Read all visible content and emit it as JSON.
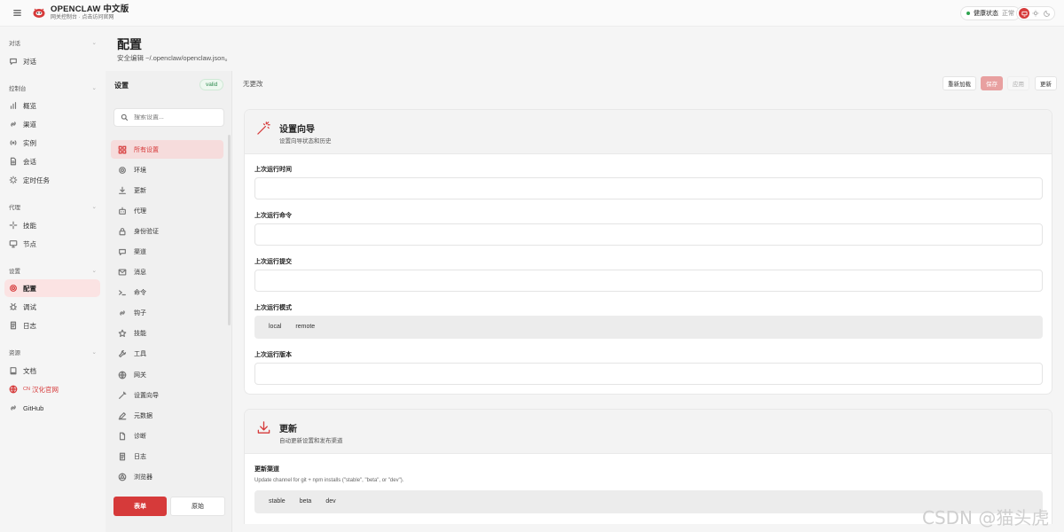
{
  "app": {
    "title": "OPENCLAW 中文版",
    "subtitle": "网关控制台 · 点击访问官网"
  },
  "health": {
    "label": "健康状态",
    "value": "正常"
  },
  "nav": {
    "sections": [
      {
        "label": "对话",
        "items": [
          {
            "label": "对话",
            "icon": "chat-bubble-icon"
          }
        ]
      },
      {
        "label": "控制台",
        "items": [
          {
            "label": "概览",
            "icon": "bar-chart-icon"
          },
          {
            "label": "渠道",
            "icon": "link-icon"
          },
          {
            "label": "实例",
            "icon": "radio-icon"
          },
          {
            "label": "会话",
            "icon": "document-icon"
          },
          {
            "label": "定时任务",
            "icon": "loader-icon"
          }
        ]
      },
      {
        "label": "代理",
        "items": [
          {
            "label": "技能",
            "icon": "sparkle-icon"
          },
          {
            "label": "节点",
            "icon": "monitor-icon"
          }
        ]
      },
      {
        "label": "设置",
        "items": [
          {
            "label": "配置",
            "icon": "gear-icon",
            "active": true
          },
          {
            "label": "调试",
            "icon": "bug-icon"
          },
          {
            "label": "日志",
            "icon": "file-text-icon"
          }
        ]
      },
      {
        "label": "资源",
        "items": [
          {
            "label": "文档",
            "icon": "book-icon"
          },
          {
            "label": "汉化官网",
            "icon": "globe-icon",
            "badge": "CN"
          },
          {
            "label": "GitHub",
            "icon": "link-icon"
          }
        ]
      }
    ]
  },
  "page": {
    "title": "配置",
    "subtitle": "安全编辑 ~/.openclaw/openclaw.json。"
  },
  "settings_panel": {
    "title": "设置",
    "status": "valid",
    "search_placeholder": "搜索设置...",
    "items": [
      {
        "label": "所有设置",
        "icon": "grid-icon",
        "active": true
      },
      {
        "label": "环境",
        "icon": "gear-icon"
      },
      {
        "label": "更新",
        "icon": "download-icon"
      },
      {
        "label": "代理",
        "icon": "robot-icon"
      },
      {
        "label": "身份验证",
        "icon": "lock-icon"
      },
      {
        "label": "渠道",
        "icon": "chat-bubble-icon"
      },
      {
        "label": "消息",
        "icon": "mail-icon"
      },
      {
        "label": "命令",
        "icon": "terminal-icon"
      },
      {
        "label": "钩子",
        "icon": "link-icon"
      },
      {
        "label": "技能",
        "icon": "star-icon"
      },
      {
        "label": "工具",
        "icon": "wrench-icon"
      },
      {
        "label": "网关",
        "icon": "globe-icon"
      },
      {
        "label": "设置向导",
        "icon": "magic-wand-icon"
      },
      {
        "label": "元数据",
        "icon": "pen-icon"
      },
      {
        "label": "诊断",
        "icon": "file-icon"
      },
      {
        "label": "日志",
        "icon": "file-text-icon"
      },
      {
        "label": "浏览器",
        "icon": "browser-icon"
      }
    ],
    "form_button": "表单",
    "raw_button": "原始"
  },
  "toolbar": {
    "status": "无更改",
    "reload": "重新加载",
    "save": "保存",
    "apply": "应用",
    "update": "更新"
  },
  "wizard_card": {
    "title": "设置向导",
    "subtitle": "设置向导状态和历史",
    "fields": {
      "last_run_time": {
        "label": "上次运行时间",
        "value": ""
      },
      "last_run_command": {
        "label": "上次运行命令",
        "value": ""
      },
      "last_run_commit": {
        "label": "上次运行提交",
        "value": ""
      },
      "last_run_mode": {
        "label": "上次运行模式",
        "options": [
          "local",
          "remote"
        ]
      },
      "last_run_version": {
        "label": "上次运行版本",
        "value": ""
      }
    }
  },
  "update_card": {
    "title": "更新",
    "subtitle": "自动更新设置和发布渠道",
    "channel": {
      "label": "更新渠道",
      "help": "Update channel for git + npm installs (\"stable\", \"beta\", or \"dev\").",
      "options": [
        "stable",
        "beta",
        "dev"
      ]
    }
  },
  "watermark": "CSDN @猫头虎",
  "colors": {
    "accent": "#d63a3a",
    "accent_light": "#fbe3e3",
    "valid": "#2e8b4f"
  }
}
